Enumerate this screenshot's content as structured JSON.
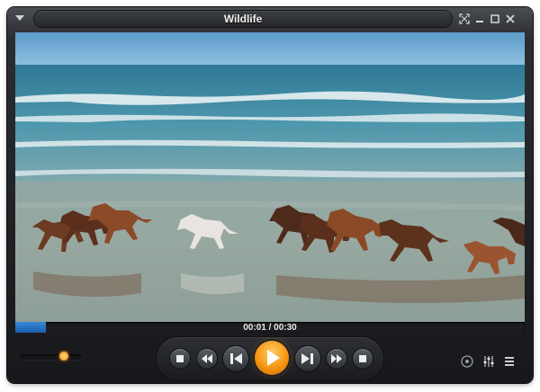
{
  "window": {
    "title": "Wildlife"
  },
  "playback": {
    "current_time": "00:01",
    "separator": " / ",
    "duration": "00:30",
    "timecode": "00:01 / 00:30",
    "progress": 0.06
  },
  "volume": {
    "level": 0.72
  },
  "icons": {
    "menu": "menu-arrow-icon",
    "fullscreen": "fullscreen-icon",
    "minimize": "minimize-icon",
    "maximize": "maximize-icon",
    "close": "close-icon",
    "stop": "stop-icon",
    "rewind": "rewind-icon",
    "previous": "previous-icon",
    "play": "play-icon",
    "next": "next-icon",
    "fast_forward": "fast-forward-icon",
    "open": "open-file-icon",
    "options": "options-icon",
    "equalizer": "equalizer-icon",
    "playlist": "playlist-icon"
  },
  "colors": {
    "accent": "#f59511",
    "progress": "#2a74c8",
    "chrome": "#1f2124"
  }
}
